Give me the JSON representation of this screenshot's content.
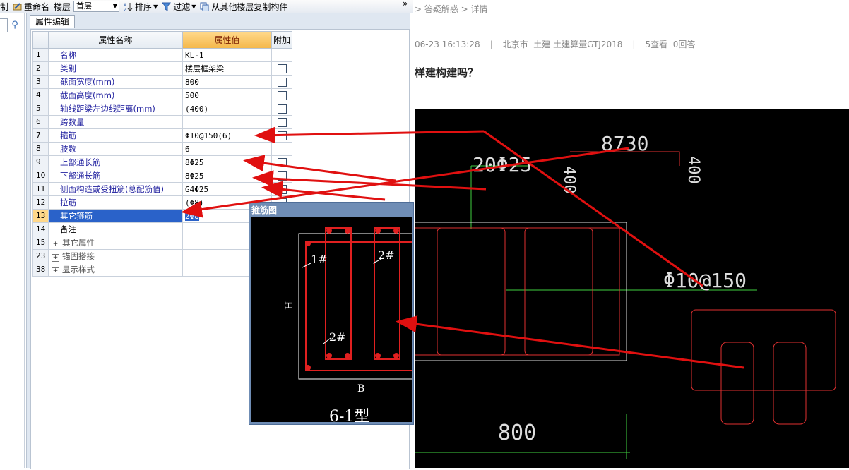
{
  "toolbar": {
    "cut_label": "制",
    "rename_label": "重命名",
    "floor_label": "楼层",
    "floor_value": "首层",
    "sort_label": "排序",
    "filter_label": "过滤",
    "copy_label": "从其他楼层复制构件",
    "overflow": "»"
  },
  "panel": {
    "tab_label": "属性编辑",
    "headers": {
      "name": "属性名称",
      "value": "属性值",
      "extra": "附加"
    },
    "rows": [
      {
        "num": "1",
        "name": "名称",
        "value": "KL-1",
        "check": false
      },
      {
        "num": "2",
        "name": "类别",
        "value": "楼层框架梁",
        "check": true
      },
      {
        "num": "3",
        "name": "截面宽度(mm)",
        "value": "800",
        "check": true
      },
      {
        "num": "4",
        "name": "截面高度(mm)",
        "value": "500",
        "check": true
      },
      {
        "num": "5",
        "name": "轴线距梁左边线距离(mm)",
        "value": "(400)",
        "check": true
      },
      {
        "num": "6",
        "name": "跨数量",
        "value": "",
        "check": true
      },
      {
        "num": "7",
        "name": "箍筋",
        "value": "Φ10@150(6)",
        "check": true
      },
      {
        "num": "8",
        "name": "肢数",
        "value": "6",
        "check": false
      },
      {
        "num": "9",
        "name": "上部通长筋",
        "value": "8Φ25",
        "check": true
      },
      {
        "num": "10",
        "name": "下部通长筋",
        "value": "8Φ25",
        "check": true
      },
      {
        "num": "11",
        "name": "侧面构造或受扭筋(总配筋值)",
        "value": "G4Φ25",
        "check": true
      },
      {
        "num": "12",
        "name": "拉筋",
        "value": "(Φ8)",
        "check": true
      },
      {
        "num": "13",
        "name": "其它箍筋",
        "value": "2Φ8",
        "check": false,
        "selected": true
      },
      {
        "num": "14",
        "name": "备注",
        "value": "",
        "check": false,
        "plain": true
      },
      {
        "num": "15",
        "name": "其它属性",
        "value": "",
        "check": false,
        "group": true
      },
      {
        "num": "23",
        "name": "锚固搭接",
        "value": "",
        "check": false,
        "group": true
      },
      {
        "num": "38",
        "name": "显示样式",
        "value": "",
        "check": false,
        "group": true
      }
    ]
  },
  "web": {
    "breadcrumb": "> 答疑解惑 > 详情",
    "meta_time": "06-23 16:13:28",
    "meta_location": "北京市",
    "meta_category": "土建 土建算量GTJ2018",
    "meta_views": "5查看",
    "meta_answers": "0回答",
    "question_title": "样建构建吗？",
    "cad_texts": {
      "top_bar": "20Φ25",
      "span": "8730",
      "h400a": "400",
      "h400b": "400",
      "stirrup": "Φ10@150",
      "width": "800"
    }
  },
  "dialog": {
    "title": "箍筋图",
    "label_1": "1#",
    "label_2a": "2#",
    "label_2b": "2#",
    "dim_h": "H",
    "dim_b": "B",
    "caption": "6-1型"
  }
}
